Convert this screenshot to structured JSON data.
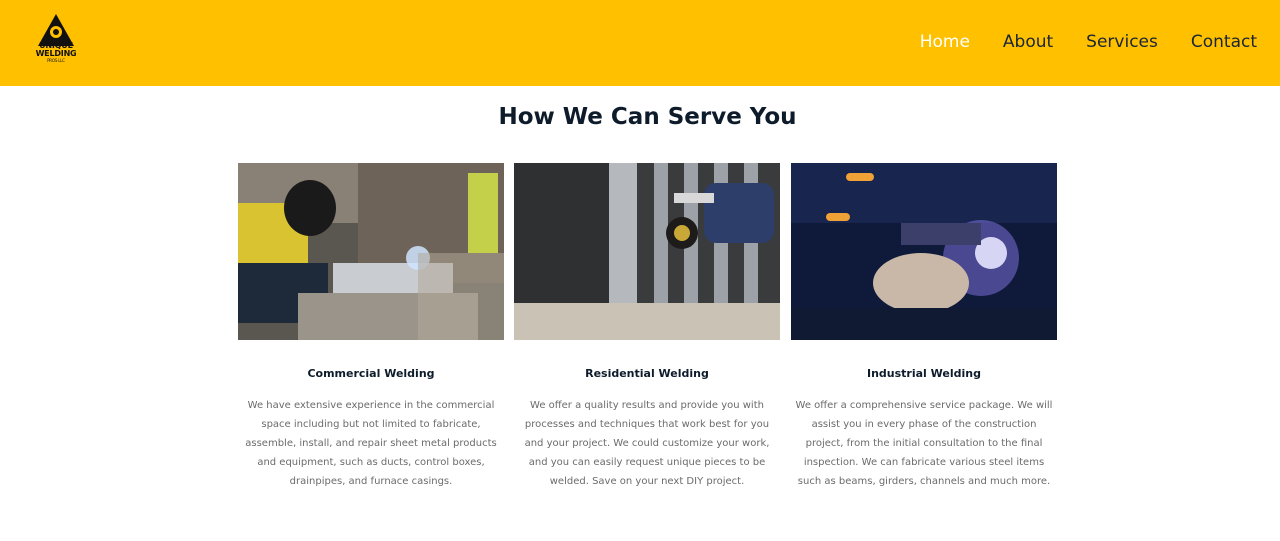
{
  "header": {
    "logo": {
      "line1": "UNIQUE",
      "line2": "WELDING",
      "line3": "PROS LLC"
    },
    "nav": [
      {
        "label": "Home",
        "active": true
      },
      {
        "label": "About",
        "active": false
      },
      {
        "label": "Services",
        "active": false
      },
      {
        "label": "Contact",
        "active": false
      }
    ],
    "background_color": "#ffc000"
  },
  "services": {
    "title": "How We Can Serve You",
    "cards": [
      {
        "title": "Commercial Welding",
        "description": "We have extensive experience in the commercial space including but not limited to fabricate, assemble, install, and repair sheet metal products and equipment, such as ducts, control boxes, drainpipes, and furnace casings.",
        "image": "welder-with-mask-photo"
      },
      {
        "title": "Residential Welding",
        "description": "We offer a quality results and provide you with processes and techniques that work best for you and your project. We could customize your work, and you can easily request unique pieces to be welded. Save on your next DIY project.",
        "image": "gloved-hand-gate-photo"
      },
      {
        "title": "Industrial Welding",
        "description": "We offer a comprehensive service package. We will assist you in every phase of the construction project, from the initial consultation to the final inspection. We can fabricate various steel items such as beams, girders, channels and much more.",
        "image": "welding-sparks-photo"
      }
    ]
  }
}
